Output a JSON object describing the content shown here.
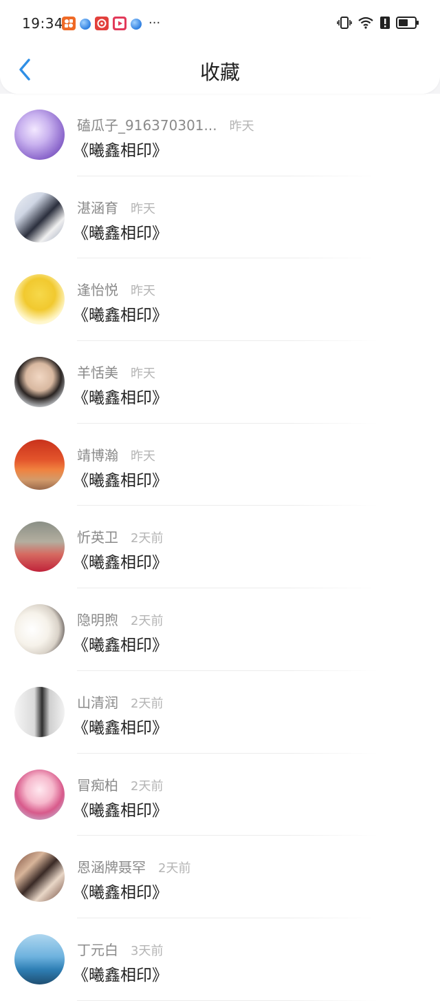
{
  "status_bar": {
    "time": "19:34",
    "notification_icons": [
      "orange-app-icon",
      "blue-ball-icon",
      "netease-music-icon",
      "video-play-icon",
      "blue-ball-icon"
    ],
    "more": "···",
    "system_icons": [
      "vibrate-icon",
      "wifi-icon",
      "alert-icon",
      "battery-icon"
    ]
  },
  "header": {
    "back_icon": "chevron-left-icon",
    "title": "收藏",
    "accent_color": "#2f8fe6"
  },
  "list": [
    {
      "name": "磕瓜子_916370301...",
      "time": "昨天",
      "content": "《曦鑫相印》",
      "avatar": "purple-unicorn"
    },
    {
      "name": "湛涵育",
      "time": "昨天",
      "content": "《曦鑫相印》",
      "avatar": "anime-couple"
    },
    {
      "name": "逢怡悦",
      "time": "昨天",
      "content": "《曦鑫相印》",
      "avatar": "minion"
    },
    {
      "name": "羊恬美",
      "time": "昨天",
      "content": "《曦鑫相印》",
      "avatar": "boy-portrait"
    },
    {
      "name": "靖博瀚",
      "time": "昨天",
      "content": "《曦鑫相印》",
      "avatar": "autumn-trees"
    },
    {
      "name": "忻英卫",
      "time": "2天前",
      "content": "《曦鑫相印》",
      "avatar": "two-people"
    },
    {
      "name": "隐明煦",
      "time": "2天前",
      "content": "《曦鑫相印》",
      "avatar": "girl-flowers"
    },
    {
      "name": "山清润",
      "time": "2天前",
      "content": "《曦鑫相印》",
      "avatar": "boy-window"
    },
    {
      "name": "冒痴柏",
      "time": "2天前",
      "content": "《曦鑫相印》",
      "avatar": "anime-pink-hair"
    },
    {
      "name": "恩涵牌聂罕",
      "time": "2天前",
      "content": "《曦鑫相印》",
      "avatar": "photo-collage"
    },
    {
      "name": "丁元白",
      "time": "3天前",
      "content": "《曦鑫相印》",
      "avatar": "sea-girl"
    }
  ]
}
